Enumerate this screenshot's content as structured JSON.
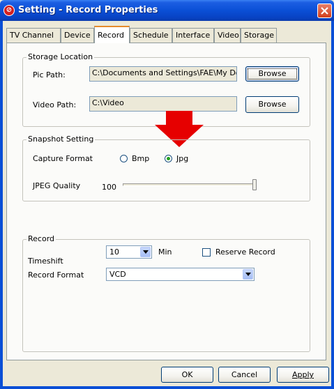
{
  "window": {
    "title": "Setting - Record Properties",
    "app_icon": "record-app-icon",
    "close_icon": "close-icon"
  },
  "tabs": [
    {
      "label": "TV Channel"
    },
    {
      "label": "Device"
    },
    {
      "label": "Record"
    },
    {
      "label": "Schedule"
    },
    {
      "label": "Interface"
    },
    {
      "label": "Video"
    },
    {
      "label": "Storage"
    }
  ],
  "active_tab": "Record",
  "storage_location": {
    "legend": "Storage Location",
    "pic_path_label": "Pic Path:",
    "pic_path_value": "C:\\Documents and Settings\\FAE\\My Do",
    "video_path_label": "Video Path:",
    "video_path_value": "C:\\Video",
    "browse_label": "Browse"
  },
  "snapshot": {
    "legend": "Snapshot Setting",
    "capture_format_label": "Capture Format",
    "options": [
      "Bmp",
      "Jpg"
    ],
    "selected": "Jpg",
    "jpeg_quality_label": "JPEG Quality",
    "jpeg_quality_value": "100",
    "jpeg_quality_fraction": 1.0
  },
  "record": {
    "legend": "Record",
    "timeshift_label": "Timeshift",
    "timeshift_value": "10",
    "timeshift_unit": "Min",
    "reserve_record_label": "Reserve Record",
    "reserve_record_checked": false,
    "record_format_label": "Record Format",
    "record_format_value": "VCD"
  },
  "footer": {
    "ok_label": "OK",
    "cancel_label": "Cancel",
    "apply_label": "Apply"
  },
  "colors": {
    "titlebar": "#0a4fd6",
    "annotation_arrow": "#e60000",
    "active_tab_accent": "#e68b2c"
  }
}
